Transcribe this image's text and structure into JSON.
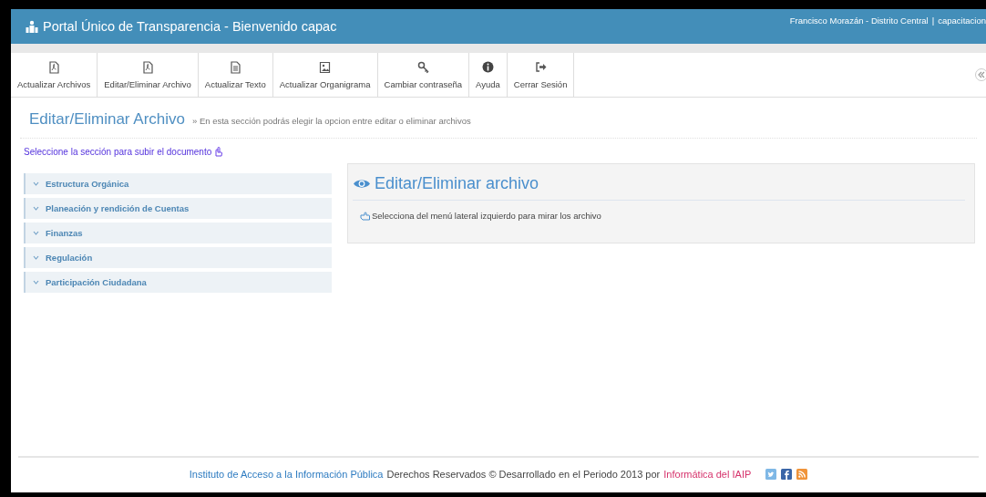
{
  "header": {
    "title": "Portal Único de Transparencia - Bienvenido capac",
    "location": "Francisco Morazán - Distrito Central",
    "separator": "|",
    "user": "capacitacion"
  },
  "toolbar": [
    {
      "kind": "pdf",
      "label": "Actualizar Archivos"
    },
    {
      "kind": "pdf",
      "label": "Editar/Eliminar Archivo"
    },
    {
      "kind": "doc",
      "label": "Actualizar Texto"
    },
    {
      "kind": "image",
      "label": "Actualizar Organigrama"
    },
    {
      "kind": "key",
      "label": "Cambiar contraseña"
    },
    {
      "kind": "info",
      "label": "Ayuda"
    },
    {
      "kind": "logout",
      "label": "Cerrar Sesión"
    }
  ],
  "page": {
    "title": "Editar/Eliminar Archivo",
    "subtitle": "» En esta sección podrás elegir la opcion entre editar o eliminar archivos"
  },
  "sidebar": {
    "prompt": "Seleccione la sección para subir el documento",
    "items": [
      {
        "label": "Estructura Orgánica",
        "expanded": false
      },
      {
        "label": "Planeación y rendición de Cuentas",
        "expanded": false
      },
      {
        "label": "Finanzas",
        "expanded": false
      },
      {
        "label": "Regulación",
        "expanded": false
      },
      {
        "label": "Participación Ciudadana",
        "expanded": false
      }
    ]
  },
  "panel": {
    "title": "Editar/Eliminar archivo",
    "message": "Selecciona del menú lateral izquierdo para mirar los archivo"
  },
  "footer": {
    "institute": "Instituto de Acceso a la Información Pública",
    "text": "Derechos Reservados © Desarrollado en el Periodo 2013 por",
    "credit": "Informática del IAIP"
  }
}
